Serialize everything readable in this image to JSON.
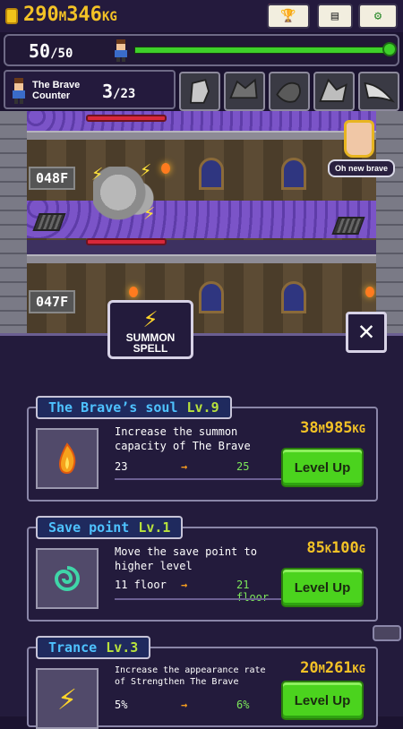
{
  "header": {
    "gold": "290",
    "gold_unit": "M",
    "gold2": "346",
    "gold2_unit": "KG"
  },
  "hp": {
    "current": "50",
    "max": "/50",
    "progress": 1.0
  },
  "counter": {
    "label_line1": "The Brave",
    "label_line2": "Counter",
    "current": "3",
    "max": "/23"
  },
  "dungeon": {
    "floor_upper": "048F",
    "floor_lower": "047F",
    "bubble": "Oh new brave"
  },
  "panel": {
    "tab_label_1": "SUMMON",
    "tab_label_2": "SPELL",
    "close": "✕"
  },
  "cards": [
    {
      "name": "The Brave’s soul",
      "level": "Lv.9",
      "desc": "Increase the summon capacity of The Brave",
      "current": "23",
      "next": "25",
      "cost_a": "38",
      "cost_a_unit": "M",
      "cost_b": "985",
      "cost_b_unit": "KG",
      "button": "Level Up",
      "icon": "flame-icon"
    },
    {
      "name": "Save point",
      "level": "Lv.1",
      "desc": "Move the save point to higher level",
      "current": "11 floor",
      "next": "21 floor",
      "cost_a": "85",
      "cost_a_unit": "K",
      "cost_b": "100",
      "cost_b_unit": "G",
      "button": "Level Up",
      "icon": "swirl-icon"
    },
    {
      "name": "Trance",
      "level": "Lv.3",
      "desc": "Increase the appearance rate of Strengthen The Brave",
      "current": "5%",
      "next": "6%",
      "cost_a": "20",
      "cost_a_unit": "M",
      "cost_b": "261",
      "cost_b_unit": "KG",
      "button": "Level Up",
      "icon": "lightning-icon"
    }
  ],
  "colors": {
    "gold": "#f3c226",
    "hp": "#3ed02a",
    "skill_name": "#4ec2ff",
    "level": "#b8e23c",
    "button": "#4bd31e"
  }
}
